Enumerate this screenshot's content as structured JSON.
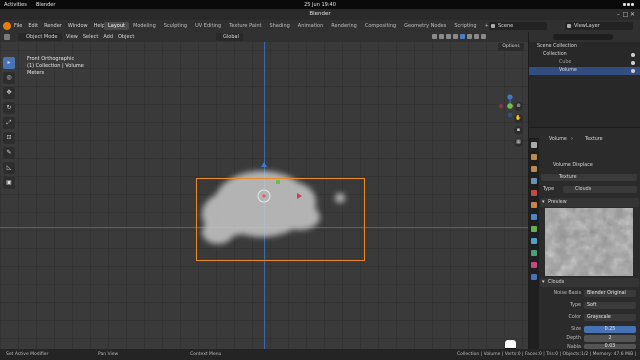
{
  "gnome": {
    "activities": "Activities",
    "app": "Blender",
    "clock": "25 Jun  19:40"
  },
  "window": {
    "title": "Blender",
    "min": "–",
    "max": "□",
    "close": "✕"
  },
  "topbar": {
    "menus": [
      "File",
      "Edit",
      "Render",
      "Window",
      "Help"
    ],
    "tabs": [
      "Layout",
      "Modeling",
      "Sculpting",
      "UV Editing",
      "Texture Paint",
      "Shading",
      "Animation",
      "Rendering",
      "Compositing",
      "Geometry Nodes",
      "Scripting"
    ],
    "active_tab": "Layout",
    "add_tab": "+",
    "scene": "Scene",
    "view_layer": "ViewLayer"
  },
  "viewport": {
    "mode": "Object Mode",
    "menus": [
      "View",
      "Select",
      "Add",
      "Object"
    ],
    "transform_orientation": "Global",
    "options": "Options",
    "info_line1": "Front Orthographic",
    "info_line2": "(1) Collection | Volume",
    "info_line3": "Meters"
  },
  "outliner": {
    "root": "Scene Collection",
    "collection": "Collection",
    "items": [
      "Cube",
      "Volume"
    ],
    "selected": "Volume"
  },
  "properties": {
    "breadcrumb_object": "Volume",
    "breadcrumb_data": "Texture",
    "modifier_name": "Volume Displace",
    "texture_name": "Texture",
    "type_label": "Type",
    "type_value": "Clouds",
    "preview_label": "Preview",
    "clouds_label": "Clouds",
    "fields": [
      {
        "label": "Noise Basis",
        "value": "Blender Original"
      },
      {
        "label": "Type",
        "value": "Soft"
      },
      {
        "label": "Color",
        "value": "Grayscale"
      },
      {
        "label": "Size",
        "value": "0.25"
      },
      {
        "label": "Depth",
        "value": "2"
      },
      {
        "label": "Nabla",
        "value": "0.03"
      }
    ]
  },
  "statusbar": {
    "left1": "Set Active Modifier",
    "left2": "Pan View",
    "left3": "Context Menu",
    "right": "Collection | Volume | Verts:0 | Faces:0 | Tris:0 | Objects:1/2 | Memory: 47.6 MiB | 3.2"
  },
  "colors": {
    "accent": "#4772b3",
    "selection_outline": "#e8892a",
    "x_axis": "#b8404a",
    "z_axis": "#3e78c8",
    "blender_logo": "#e87d0d"
  }
}
